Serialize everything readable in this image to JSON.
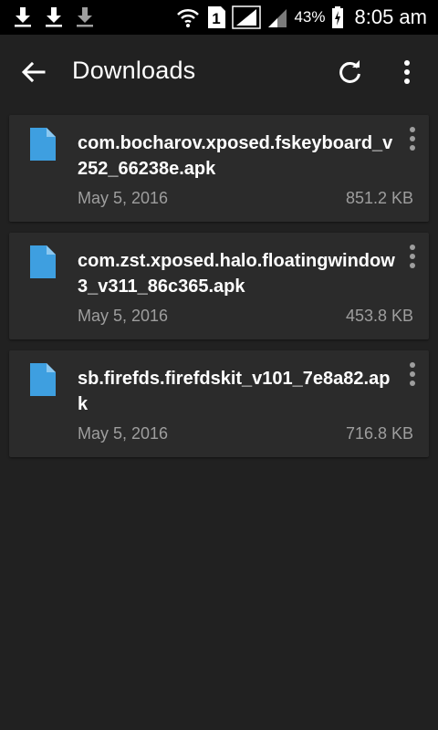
{
  "status_bar": {
    "battery_percent": "43%",
    "time": "8:05 am",
    "sim_slot": "1",
    "notification_icons": [
      "download-icon",
      "download-icon",
      "download-icon"
    ]
  },
  "app_bar": {
    "title": "Downloads",
    "icons": [
      "back-arrow-icon",
      "refresh-icon",
      "more-vert-icon"
    ]
  },
  "files": [
    {
      "name": "com.bocharov.xposed.fskeyboard_v252_66238e.apk",
      "date": "May 5, 2016",
      "size": "851.2 KB"
    },
    {
      "name": "com.zst.xposed.halo.floatingwindow3_v311_86c365.apk",
      "date": "May 5, 2016",
      "size": "453.8 KB"
    },
    {
      "name": "sb.firefds.firefdskit_v101_7e8a82.apk",
      "date": "May 5, 2016",
      "size": "716.8 KB"
    }
  ],
  "colors": {
    "background": "#212121",
    "card": "#2b2b2b",
    "file_icon": "#3e9fe0",
    "secondary_text": "#9e9e9e"
  }
}
